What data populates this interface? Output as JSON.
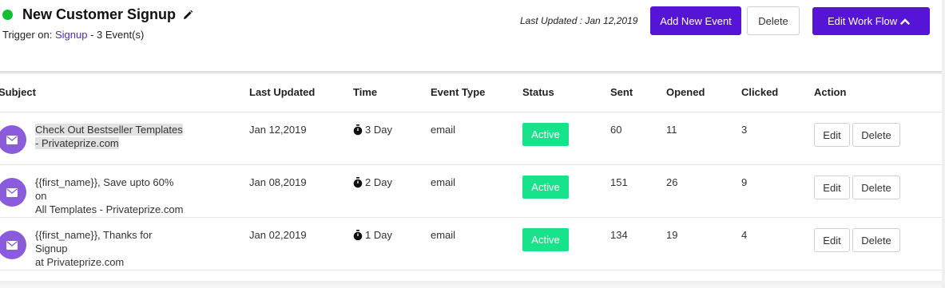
{
  "header": {
    "title": "New Customer Signup",
    "trigger_prefix": "Trigger on: ",
    "trigger_link": "Signup",
    "trigger_suffix": " - 3 Event(s)",
    "last_updated": "Last Updated : Jan 12,2019",
    "add_label": "Add New Event",
    "delete_label": "Delete",
    "workflow_label": "Edit Work Flow"
  },
  "columns": [
    "Subject",
    "Last Updated",
    "Time",
    "Event Type",
    "Status",
    "Sent",
    "Opened",
    "Clicked",
    "Action"
  ],
  "rows": [
    {
      "subject_l1": "Check Out Bestseller Templates",
      "subject_l2": "- Privateprize.com",
      "last_updated": "Jan 12,2019",
      "time": "3 Day",
      "event_type": "email",
      "status": "Active",
      "sent": "60",
      "opened": "11",
      "clicked": "3",
      "edit": "Edit",
      "delete": "Delete"
    },
    {
      "subject_l1": "{{first_name}}, Save upto 60% on",
      "subject_l2": "All Templates - Privateprize.com",
      "last_updated": "Jan 08,2019",
      "time": "2 Day",
      "event_type": "email",
      "status": "Active",
      "sent": "151",
      "opened": "26",
      "clicked": "9",
      "edit": "Edit",
      "delete": "Delete"
    },
    {
      "subject_l1": "{{first_name}}, Thanks for Signup",
      "subject_l2": "at Privateprize.com",
      "last_updated": "Jan 02,2019",
      "time": "1 Day",
      "event_type": "email",
      "status": "Active",
      "sent": "134",
      "opened": "19",
      "clicked": "4",
      "edit": "Edit",
      "delete": "Delete"
    }
  ],
  "icons": {
    "status": "status-dot-icon",
    "edit_title": "pencil-icon",
    "workflow": "chevron-up-icon",
    "row": "envelope-icon",
    "time": "stopwatch-icon"
  },
  "colors": {
    "primary": "#5514d6",
    "active": "#18e28a",
    "online": "#10c030",
    "avatar": "#8a5cdd",
    "link": "#4a2bc9"
  }
}
